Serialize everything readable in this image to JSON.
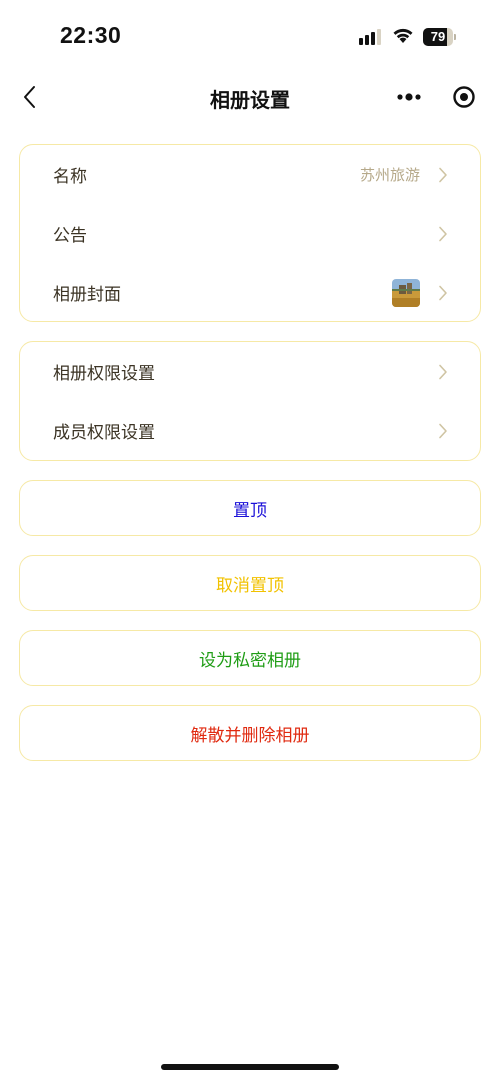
{
  "status_bar": {
    "time": "22:30",
    "battery_percent": "79",
    "battery_level": 0.79,
    "icons": [
      "signal-icon",
      "wifi-icon",
      "battery-icon"
    ]
  },
  "nav": {
    "title": "相册设置",
    "back_icon": "back-chevron-icon",
    "more_icon": "more-dots-icon",
    "target_icon": "target-icon"
  },
  "settings_group_1": {
    "name_label": "名称",
    "name_value": "苏州旅游",
    "announcement_label": "公告",
    "cover_label": "相册封面"
  },
  "settings_group_2": {
    "album_permission_label": "相册权限设置",
    "member_permission_label": "成员权限设置"
  },
  "actions": {
    "pin": {
      "label": "置顶",
      "color": "#1a0fd8"
    },
    "unpin": {
      "label": "取消置顶",
      "color": "#f2c200"
    },
    "make_private": {
      "label": "设为私密相册",
      "color": "#1f9d15"
    },
    "dissolve": {
      "label": "解散并删除相册",
      "color": "#e02a10"
    }
  },
  "colors": {
    "card_border": "#f6e9a6",
    "chevron": "#cfc4a3",
    "value_text": "#b6a98a"
  }
}
